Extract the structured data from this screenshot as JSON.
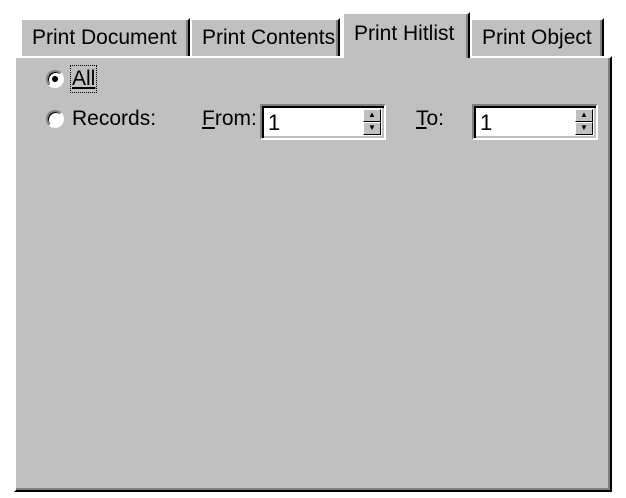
{
  "tabs": [
    {
      "label": "Print Document",
      "active": false
    },
    {
      "label": "Print Contents",
      "active": false
    },
    {
      "label": "Print Hitlist",
      "active": true
    },
    {
      "label": "Print Object",
      "active": false
    }
  ],
  "options": {
    "all_label": "All",
    "records_label": "Records:",
    "selected": "all"
  },
  "range": {
    "from_label": "From:",
    "from_value": "1",
    "to_label": "To:",
    "to_value": "1"
  }
}
